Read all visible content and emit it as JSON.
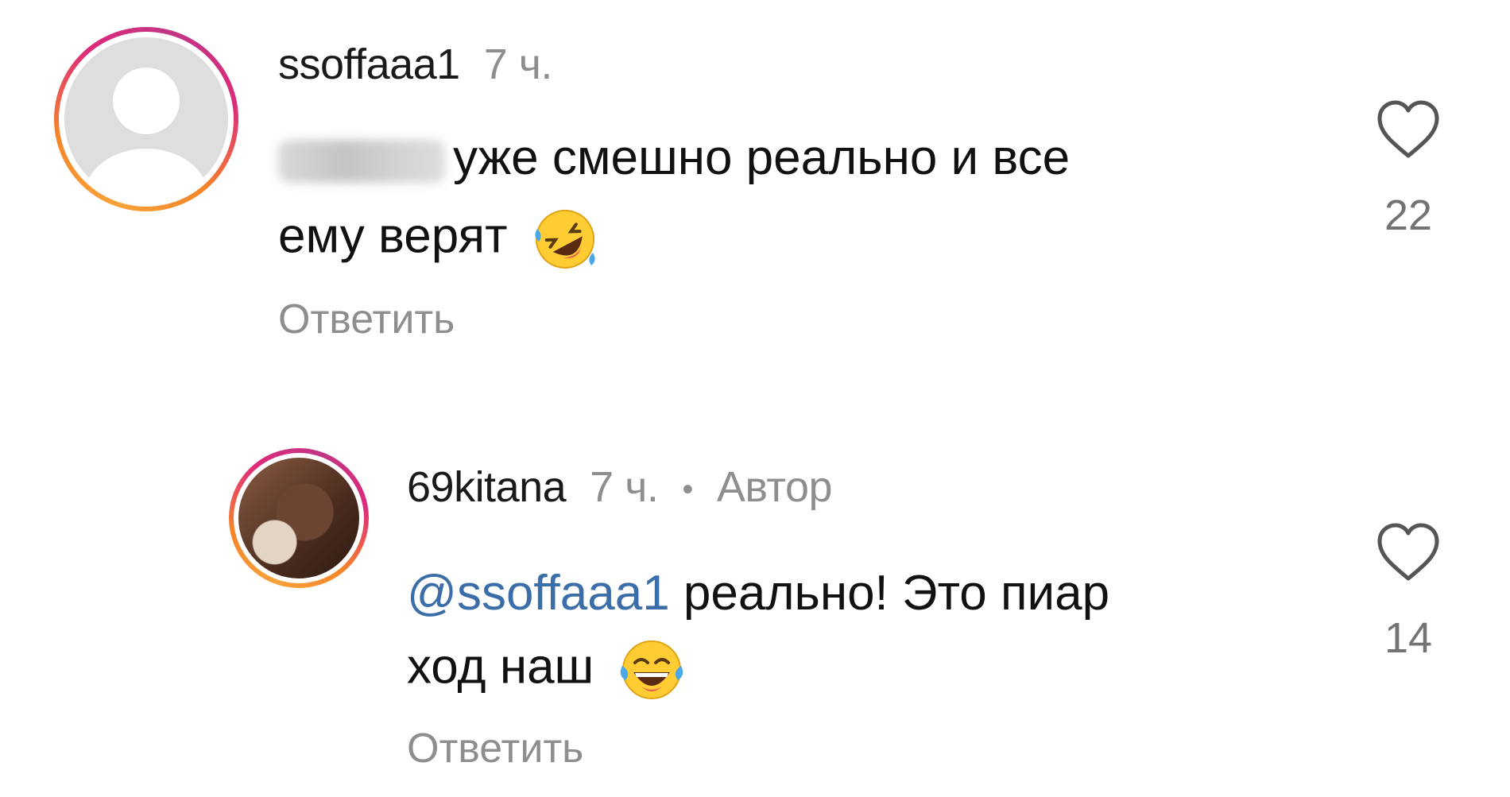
{
  "comments": [
    {
      "username": "ssoffaaa1",
      "time": "7 ч.",
      "line1": "уже смешно реально и все",
      "line2": "ему верят",
      "emoji": "rolling-on-floor-laughing",
      "reply_label": "Ответить",
      "likes": "22"
    },
    {
      "username": "69kitana",
      "time": "7 ч.",
      "dot": "•",
      "author_badge": "Автор",
      "mention": "@ssoffaaa1",
      "line1_rest": " реально! Это пиар",
      "line2": "ход наш",
      "emoji": "tears-of-joy",
      "reply_label": "Ответить",
      "likes": "14"
    }
  ],
  "colors": {
    "mention": "#3b6ea8",
    "muted": "#8e8e8e",
    "ring_start": "#f58529",
    "ring_mid": "#dd2a7b",
    "ring_end": "#8134af"
  },
  "icons": {
    "like": "heart-outline-icon",
    "avatar_placeholder": "default-user-icon"
  }
}
